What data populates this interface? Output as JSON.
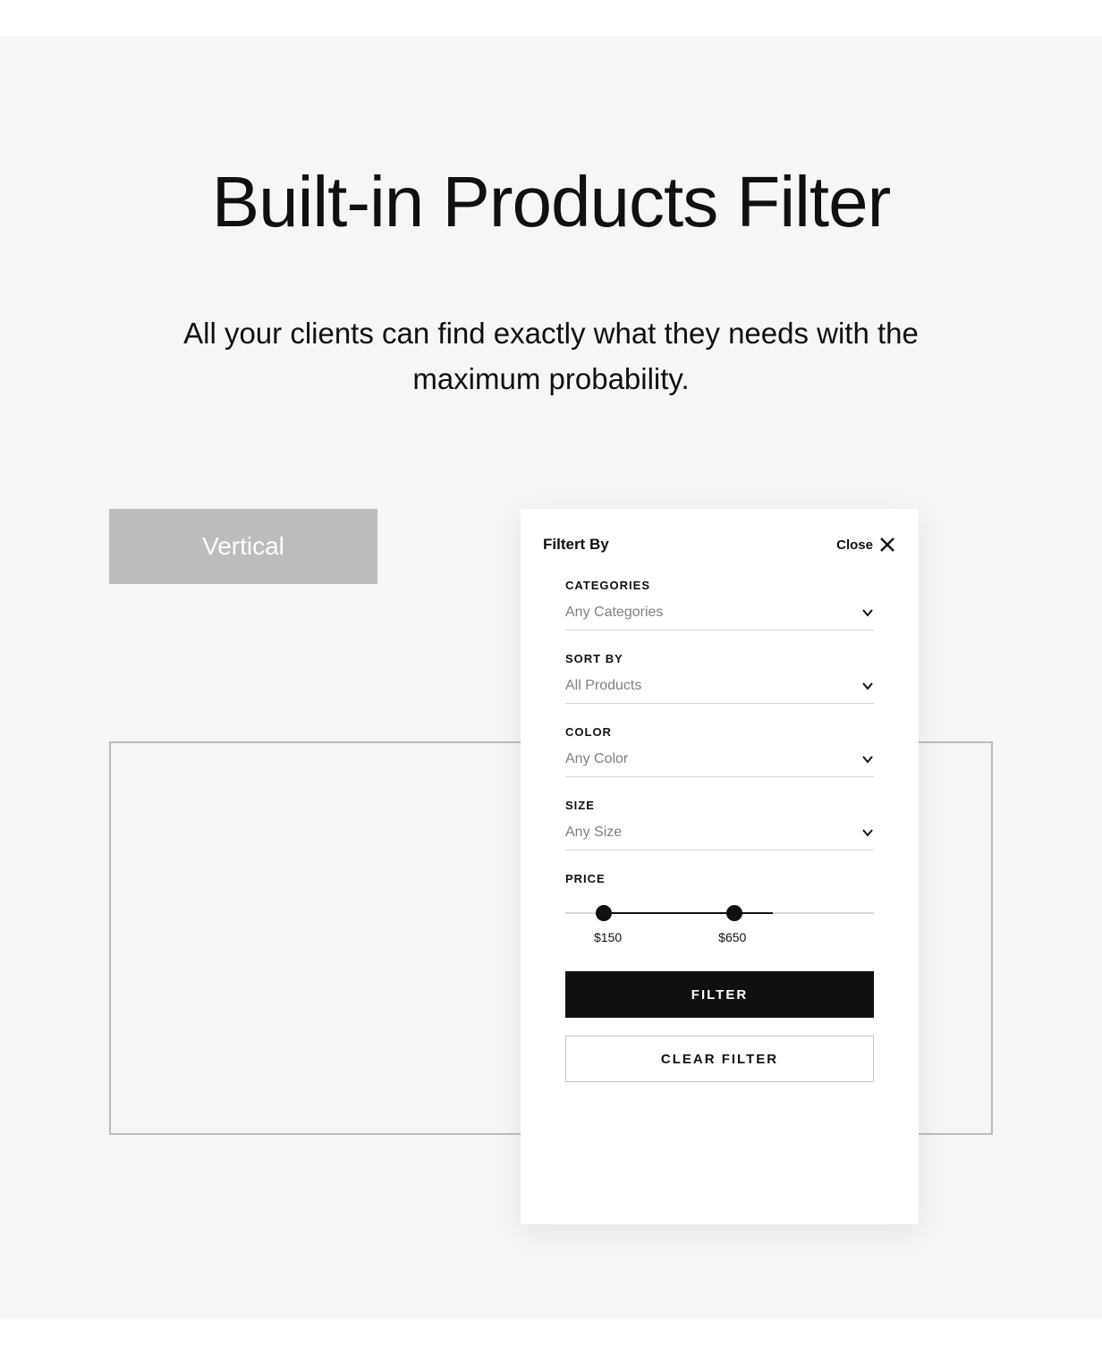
{
  "header": {
    "title": "Built-in Products Filter",
    "subtitle": "All your clients can find exactly what they needs with the maximum probability."
  },
  "tab": {
    "label": "Vertical"
  },
  "panel": {
    "title": "Filtert By",
    "close_label": "Close",
    "sections": {
      "categories": {
        "label": "CATEGORIES",
        "value": "Any Categories"
      },
      "sortby": {
        "label": "SORT BY",
        "value": "All Products"
      },
      "color": {
        "label": "COLOR",
        "value": "Any Color"
      },
      "size": {
        "label": "SIZE",
        "value": "Any Size"
      },
      "price": {
        "label": "PRICE",
        "min": "$150",
        "max": "$650"
      }
    },
    "buttons": {
      "filter": "FILTER",
      "clear": "CLEAR FILTER"
    }
  }
}
